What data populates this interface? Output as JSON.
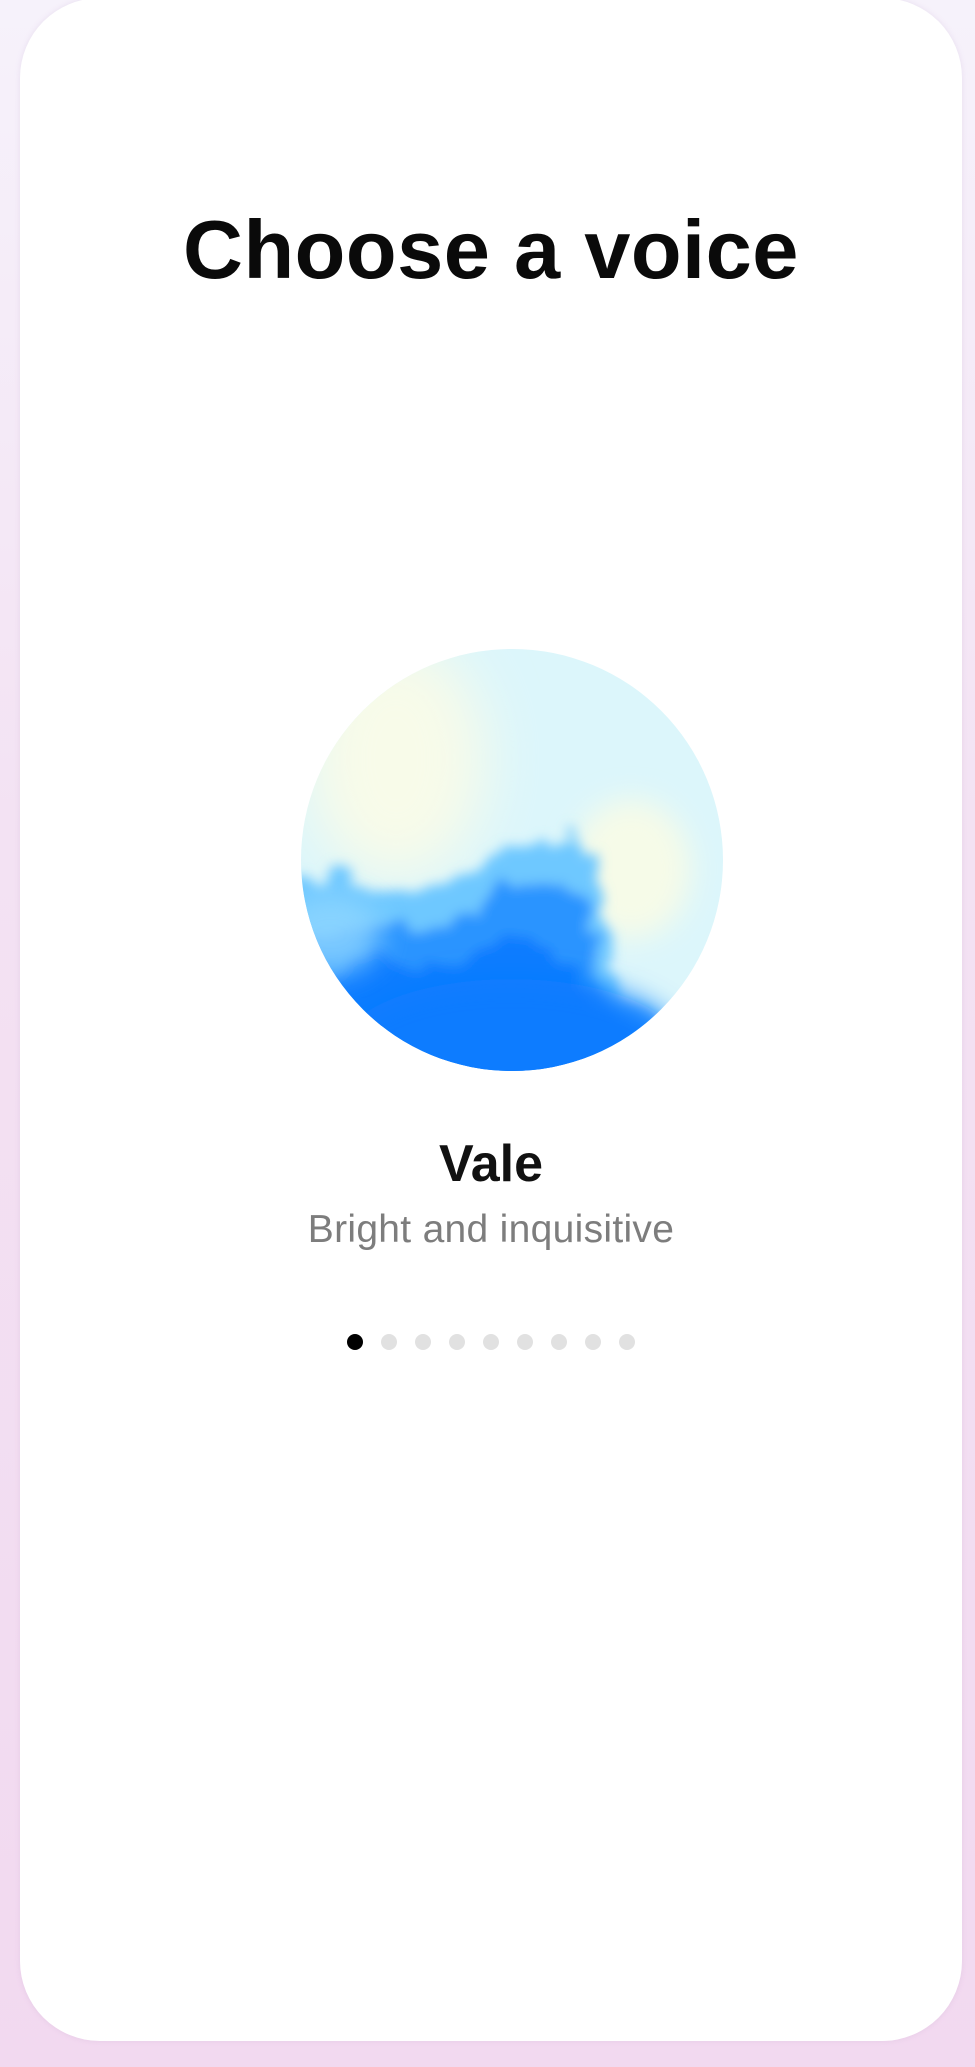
{
  "screen": {
    "title": "Choose a voice"
  },
  "voice": {
    "name": "Vale",
    "description": "Bright and inquisitive",
    "orb_colors": {
      "light": "#dcf6fb",
      "cream": "#f8fbe9",
      "mid": "#6ec8ff",
      "deep": "#0a7bff"
    }
  },
  "pager": {
    "count": 9,
    "active_index": 0,
    "active_color": "#000000",
    "inactive_color": "#e1e1e1"
  },
  "colors": {
    "background_top": "#f6f2fb",
    "background_bottom": "#f2d9f0",
    "sheet": "#ffffff"
  }
}
